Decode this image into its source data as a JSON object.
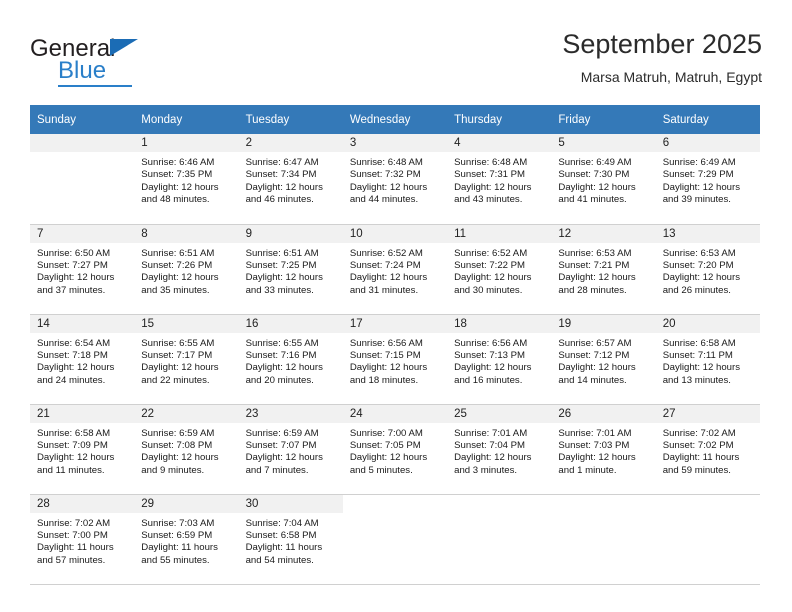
{
  "brand": {
    "name_part1": "General",
    "name_part2": "Blue",
    "triangle_icon": "triangle-icon",
    "accent_color": "#2a7fc9"
  },
  "header": {
    "title": "September 2025",
    "subtitle": "Marsa Matruh, Matruh, Egypt"
  },
  "calendar": {
    "header_bg": "#3479b8",
    "daynum_bg": "#f1f1f1",
    "weekday_headers": [
      "Sunday",
      "Monday",
      "Tuesday",
      "Wednesday",
      "Thursday",
      "Friday",
      "Saturday"
    ],
    "weeks": [
      [
        {
          "day": "",
          "sunrise": "",
          "sunset": "",
          "daylight1": "",
          "daylight2": "",
          "state": "empty"
        },
        {
          "day": "1",
          "sunrise": "Sunrise: 6:46 AM",
          "sunset": "Sunset: 7:35 PM",
          "daylight1": "Daylight: 12 hours",
          "daylight2": "and 48 minutes.",
          "state": "filled"
        },
        {
          "day": "2",
          "sunrise": "Sunrise: 6:47 AM",
          "sunset": "Sunset: 7:34 PM",
          "daylight1": "Daylight: 12 hours",
          "daylight2": "and 46 minutes.",
          "state": "filled"
        },
        {
          "day": "3",
          "sunrise": "Sunrise: 6:48 AM",
          "sunset": "Sunset: 7:32 PM",
          "daylight1": "Daylight: 12 hours",
          "daylight2": "and 44 minutes.",
          "state": "filled"
        },
        {
          "day": "4",
          "sunrise": "Sunrise: 6:48 AM",
          "sunset": "Sunset: 7:31 PM",
          "daylight1": "Daylight: 12 hours",
          "daylight2": "and 43 minutes.",
          "state": "filled"
        },
        {
          "day": "5",
          "sunrise": "Sunrise: 6:49 AM",
          "sunset": "Sunset: 7:30 PM",
          "daylight1": "Daylight: 12 hours",
          "daylight2": "and 41 minutes.",
          "state": "filled"
        },
        {
          "day": "6",
          "sunrise": "Sunrise: 6:49 AM",
          "sunset": "Sunset: 7:29 PM",
          "daylight1": "Daylight: 12 hours",
          "daylight2": "and 39 minutes.",
          "state": "filled"
        }
      ],
      [
        {
          "day": "7",
          "sunrise": "Sunrise: 6:50 AM",
          "sunset": "Sunset: 7:27 PM",
          "daylight1": "Daylight: 12 hours",
          "daylight2": "and 37 minutes.",
          "state": "filled"
        },
        {
          "day": "8",
          "sunrise": "Sunrise: 6:51 AM",
          "sunset": "Sunset: 7:26 PM",
          "daylight1": "Daylight: 12 hours",
          "daylight2": "and 35 minutes.",
          "state": "filled"
        },
        {
          "day": "9",
          "sunrise": "Sunrise: 6:51 AM",
          "sunset": "Sunset: 7:25 PM",
          "daylight1": "Daylight: 12 hours",
          "daylight2": "and 33 minutes.",
          "state": "filled"
        },
        {
          "day": "10",
          "sunrise": "Sunrise: 6:52 AM",
          "sunset": "Sunset: 7:24 PM",
          "daylight1": "Daylight: 12 hours",
          "daylight2": "and 31 minutes.",
          "state": "filled"
        },
        {
          "day": "11",
          "sunrise": "Sunrise: 6:52 AM",
          "sunset": "Sunset: 7:22 PM",
          "daylight1": "Daylight: 12 hours",
          "daylight2": "and 30 minutes.",
          "state": "filled"
        },
        {
          "day": "12",
          "sunrise": "Sunrise: 6:53 AM",
          "sunset": "Sunset: 7:21 PM",
          "daylight1": "Daylight: 12 hours",
          "daylight2": "and 28 minutes.",
          "state": "filled"
        },
        {
          "day": "13",
          "sunrise": "Sunrise: 6:53 AM",
          "sunset": "Sunset: 7:20 PM",
          "daylight1": "Daylight: 12 hours",
          "daylight2": "and 26 minutes.",
          "state": "filled"
        }
      ],
      [
        {
          "day": "14",
          "sunrise": "Sunrise: 6:54 AM",
          "sunset": "Sunset: 7:18 PM",
          "daylight1": "Daylight: 12 hours",
          "daylight2": "and 24 minutes.",
          "state": "filled"
        },
        {
          "day": "15",
          "sunrise": "Sunrise: 6:55 AM",
          "sunset": "Sunset: 7:17 PM",
          "daylight1": "Daylight: 12 hours",
          "daylight2": "and 22 minutes.",
          "state": "filled"
        },
        {
          "day": "16",
          "sunrise": "Sunrise: 6:55 AM",
          "sunset": "Sunset: 7:16 PM",
          "daylight1": "Daylight: 12 hours",
          "daylight2": "and 20 minutes.",
          "state": "filled"
        },
        {
          "day": "17",
          "sunrise": "Sunrise: 6:56 AM",
          "sunset": "Sunset: 7:15 PM",
          "daylight1": "Daylight: 12 hours",
          "daylight2": "and 18 minutes.",
          "state": "filled"
        },
        {
          "day": "18",
          "sunrise": "Sunrise: 6:56 AM",
          "sunset": "Sunset: 7:13 PM",
          "daylight1": "Daylight: 12 hours",
          "daylight2": "and 16 minutes.",
          "state": "filled"
        },
        {
          "day": "19",
          "sunrise": "Sunrise: 6:57 AM",
          "sunset": "Sunset: 7:12 PM",
          "daylight1": "Daylight: 12 hours",
          "daylight2": "and 14 minutes.",
          "state": "filled"
        },
        {
          "day": "20",
          "sunrise": "Sunrise: 6:58 AM",
          "sunset": "Sunset: 7:11 PM",
          "daylight1": "Daylight: 12 hours",
          "daylight2": "and 13 minutes.",
          "state": "filled"
        }
      ],
      [
        {
          "day": "21",
          "sunrise": "Sunrise: 6:58 AM",
          "sunset": "Sunset: 7:09 PM",
          "daylight1": "Daylight: 12 hours",
          "daylight2": "and 11 minutes.",
          "state": "filled"
        },
        {
          "day": "22",
          "sunrise": "Sunrise: 6:59 AM",
          "sunset": "Sunset: 7:08 PM",
          "daylight1": "Daylight: 12 hours",
          "daylight2": "and 9 minutes.",
          "state": "filled"
        },
        {
          "day": "23",
          "sunrise": "Sunrise: 6:59 AM",
          "sunset": "Sunset: 7:07 PM",
          "daylight1": "Daylight: 12 hours",
          "daylight2": "and 7 minutes.",
          "state": "filled"
        },
        {
          "day": "24",
          "sunrise": "Sunrise: 7:00 AM",
          "sunset": "Sunset: 7:05 PM",
          "daylight1": "Daylight: 12 hours",
          "daylight2": "and 5 minutes.",
          "state": "filled"
        },
        {
          "day": "25",
          "sunrise": "Sunrise: 7:01 AM",
          "sunset": "Sunset: 7:04 PM",
          "daylight1": "Daylight: 12 hours",
          "daylight2": "and 3 minutes.",
          "state": "filled"
        },
        {
          "day": "26",
          "sunrise": "Sunrise: 7:01 AM",
          "sunset": "Sunset: 7:03 PM",
          "daylight1": "Daylight: 12 hours",
          "daylight2": "and 1 minute.",
          "state": "filled"
        },
        {
          "day": "27",
          "sunrise": "Sunrise: 7:02 AM",
          "sunset": "Sunset: 7:02 PM",
          "daylight1": "Daylight: 11 hours",
          "daylight2": "and 59 minutes.",
          "state": "filled"
        }
      ],
      [
        {
          "day": "28",
          "sunrise": "Sunrise: 7:02 AM",
          "sunset": "Sunset: 7:00 PM",
          "daylight1": "Daylight: 11 hours",
          "daylight2": "and 57 minutes.",
          "state": "filled"
        },
        {
          "day": "29",
          "sunrise": "Sunrise: 7:03 AM",
          "sunset": "Sunset: 6:59 PM",
          "daylight1": "Daylight: 11 hours",
          "daylight2": "and 55 minutes.",
          "state": "filled"
        },
        {
          "day": "30",
          "sunrise": "Sunrise: 7:04 AM",
          "sunset": "Sunset: 6:58 PM",
          "daylight1": "Daylight: 11 hours",
          "daylight2": "and 54 minutes.",
          "state": "filled"
        },
        {
          "day": "",
          "sunrise": "",
          "sunset": "",
          "daylight1": "",
          "daylight2": "",
          "state": "blank"
        },
        {
          "day": "",
          "sunrise": "",
          "sunset": "",
          "daylight1": "",
          "daylight2": "",
          "state": "blank"
        },
        {
          "day": "",
          "sunrise": "",
          "sunset": "",
          "daylight1": "",
          "daylight2": "",
          "state": "blank"
        },
        {
          "day": "",
          "sunrise": "",
          "sunset": "",
          "daylight1": "",
          "daylight2": "",
          "state": "blank"
        }
      ]
    ]
  }
}
